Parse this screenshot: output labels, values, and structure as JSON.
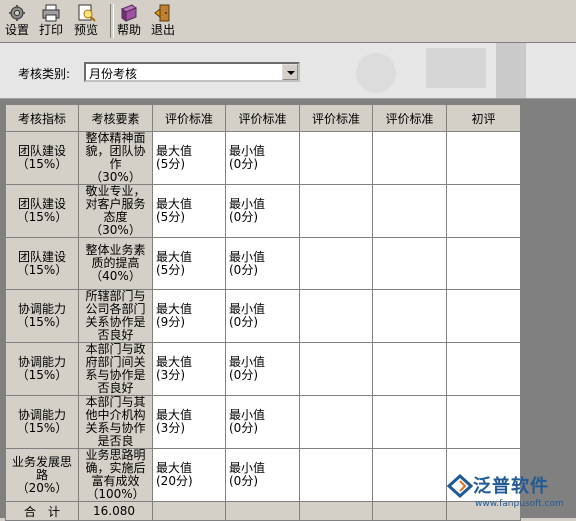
{
  "toolbar": {
    "buttons": [
      {
        "label": "设置",
        "icon": "settings-gear-icon"
      },
      {
        "label": "打印",
        "icon": "printer-icon"
      },
      {
        "label": "预览",
        "icon": "preview-icon"
      },
      {
        "label": "帮助",
        "icon": "help-book-icon"
      },
      {
        "label": "退出",
        "icon": "exit-door-icon"
      }
    ]
  },
  "filter": {
    "label": "考核类别:",
    "selected": "月份考核"
  },
  "table": {
    "headers": [
      "考核指标",
      "考核要素",
      "评价标准",
      "评价标准",
      "评价标准",
      "评价标准",
      "初评"
    ],
    "rows": [
      {
        "indicator": [
          "团队建设",
          "（15%）"
        ],
        "factor": [
          "整体精神面",
          "貌，团队协",
          "作",
          "（30%）"
        ],
        "max": [
          "最大值",
          "(5分)"
        ],
        "min": [
          "最小值",
          "(0分)"
        ]
      },
      {
        "indicator": [
          "团队建设",
          "（15%）"
        ],
        "factor": [
          "敬业专业，",
          "对客户服务",
          "态度",
          "（30%）"
        ],
        "max": [
          "最大值",
          "(5分)"
        ],
        "min": [
          "最小值",
          "(0分)"
        ]
      },
      {
        "indicator": [
          "团队建设",
          "（15%）"
        ],
        "factor": [
          "整体业务素",
          "质的提高",
          "（40%）"
        ],
        "max": [
          "最大值",
          "(5分)"
        ],
        "min": [
          "最小值",
          "(0分)"
        ]
      },
      {
        "indicator": [
          "协调能力",
          "（15%）"
        ],
        "factor": [
          "所辖部门与",
          "公司各部门",
          "关系协作是",
          "否良好"
        ],
        "max": [
          "最大值",
          "(9分)"
        ],
        "min": [
          "最小值",
          "(0分)"
        ]
      },
      {
        "indicator": [
          "协调能力",
          "（15%）"
        ],
        "factor": [
          "本部门与政",
          "府部门间关",
          "系与协作是",
          "否良好"
        ],
        "max": [
          "最大值",
          "(3分)"
        ],
        "min": [
          "最小值",
          "(0分)"
        ]
      },
      {
        "indicator": [
          "协调能力",
          "（15%）"
        ],
        "factor": [
          "本部门与其",
          "他中介机构",
          "关系与协作",
          "是否良"
        ],
        "max": [
          "最大值",
          "(3分)"
        ],
        "min": [
          "最小值",
          "(0分)"
        ]
      },
      {
        "indicator": [
          "业务发展思",
          "路",
          "（20%）"
        ],
        "factor": [
          "业务思路明",
          "确，实施后",
          "富有成效",
          "（100%）"
        ],
        "max": [
          "最大值",
          "(20分)"
        ],
        "min": [
          "最小值",
          "(0分)"
        ]
      }
    ],
    "total": {
      "label": "合　计",
      "value": "16.080"
    }
  },
  "watermark": {
    "name": "泛普软件",
    "url": "www.fanpusoft.com",
    "color": "#1f5a96"
  },
  "colors": {
    "window_bg": "#d4d0c8",
    "grid_bg": "#808080",
    "cell_bg": "#ffffff"
  }
}
